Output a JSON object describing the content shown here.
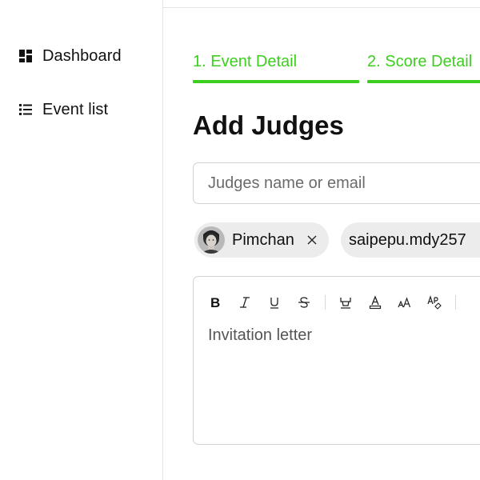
{
  "sidebar": {
    "items": [
      {
        "label": "Dashboard",
        "icon": "dashboard-icon"
      },
      {
        "label": "Event list",
        "icon": "list-icon"
      }
    ]
  },
  "steps": [
    {
      "label": "1. Event Detail",
      "state": "active"
    },
    {
      "label": "2. Score Detail",
      "state": "active"
    }
  ],
  "page": {
    "title": "Add Judges"
  },
  "search": {
    "placeholder": "Judges name or email",
    "value": ""
  },
  "chips": [
    {
      "name": "Pimchan",
      "avatar": "avatar-photo",
      "removable": true
    },
    {
      "name": "saipepu.mdy257",
      "removable": false
    }
  ],
  "editor": {
    "placeholder": "Invitation letter",
    "tools": [
      "bold-icon",
      "italic-icon",
      "underline-icon",
      "strikethrough-icon",
      "highlight-icon",
      "text-color-icon",
      "font-size-icon",
      "clear-format-icon"
    ]
  },
  "colors": {
    "accent": "#3ccf1f",
    "text": "#111111",
    "border": "#d2d2d2",
    "chip_bg": "#ececec"
  }
}
